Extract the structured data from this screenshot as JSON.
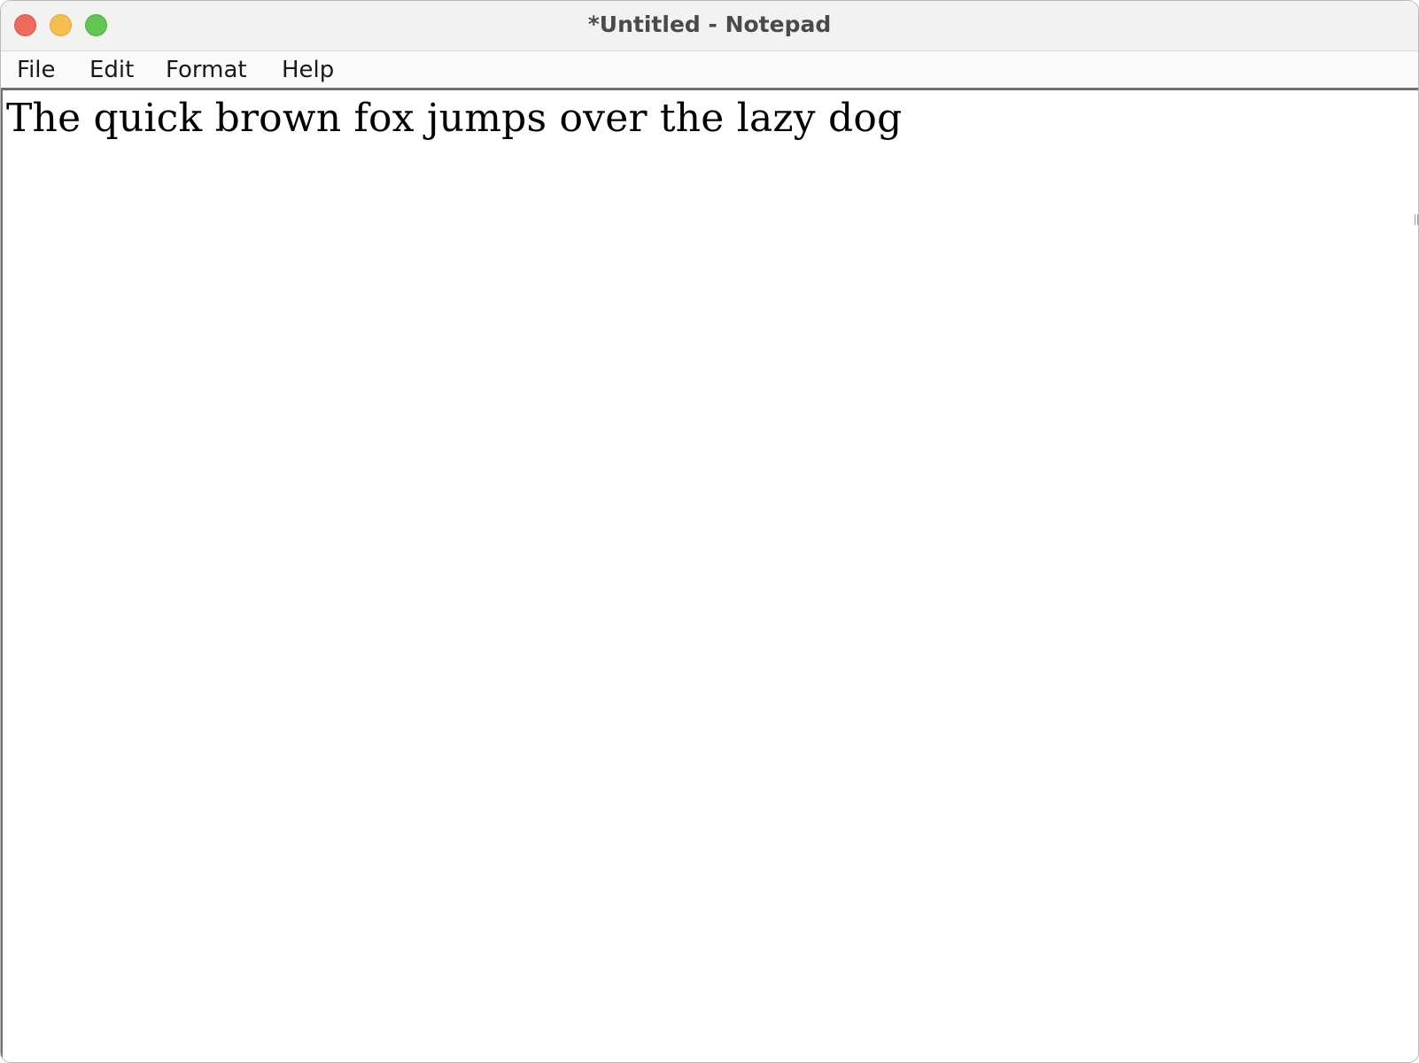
{
  "window": {
    "title": "*Untitled - Notepad"
  },
  "menubar": {
    "items": [
      {
        "label": "File"
      },
      {
        "label": "Edit"
      },
      {
        "label": "Format"
      },
      {
        "label": "Help"
      }
    ]
  },
  "editor": {
    "content": "The quick brown fox jumps over the lazy dog"
  },
  "colors": {
    "close": "#ee6a5f",
    "minimize": "#f5bf4f",
    "zoom": "#62c554"
  }
}
